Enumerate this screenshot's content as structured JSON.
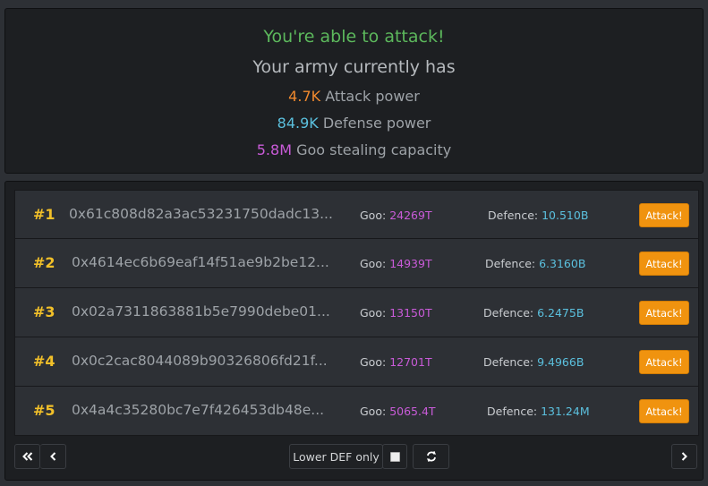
{
  "status": {
    "headline": "You're able to attack!",
    "subtitle": "Your army currently has",
    "attack_value": "4.7K",
    "attack_label": "Attack power",
    "defense_value": "84.9K",
    "defense_label": "Defense power",
    "goo_value": "5.8M",
    "goo_label": "Goo stealing capacity"
  },
  "labels": {
    "goo": "Goo:",
    "defence": "Defence:",
    "attack_button": "Attack!"
  },
  "targets": [
    {
      "rank": "#1",
      "address": "0x61c808d82a3ac53231750dadc13...",
      "goo": "24269T",
      "defence": "10.510B"
    },
    {
      "rank": "#2",
      "address": "0x4614ec6b69eaf14f51ae9b2be12...",
      "goo": "14939T",
      "defence": "6.3160B"
    },
    {
      "rank": "#3",
      "address": "0x02a7311863881b5e7990debe01...",
      "goo": "13150T",
      "defence": "6.2475B"
    },
    {
      "rank": "#4",
      "address": "0x0c2cac8044089b90326806fd21f...",
      "goo": "12701T",
      "defence": "9.4966B"
    },
    {
      "rank": "#5",
      "address": "0x4a4c35280bc7e7f426453db48e...",
      "goo": "5065.4T",
      "defence": "131.24M"
    }
  ],
  "toolbar": {
    "filter_label": "Lower DEF only",
    "filter_checked": false
  },
  "icons": {
    "first": "double-chevron-left-icon",
    "prev": "chevron-left-icon",
    "next": "chevron-right-icon",
    "refresh": "refresh-icon"
  },
  "colors": {
    "headline": "#5cb85c",
    "attack": "#f0892e",
    "defense": "#5bc0de",
    "goo": "#c95bd8",
    "rank": "#f2c029",
    "attack_button": "#f0930f"
  }
}
